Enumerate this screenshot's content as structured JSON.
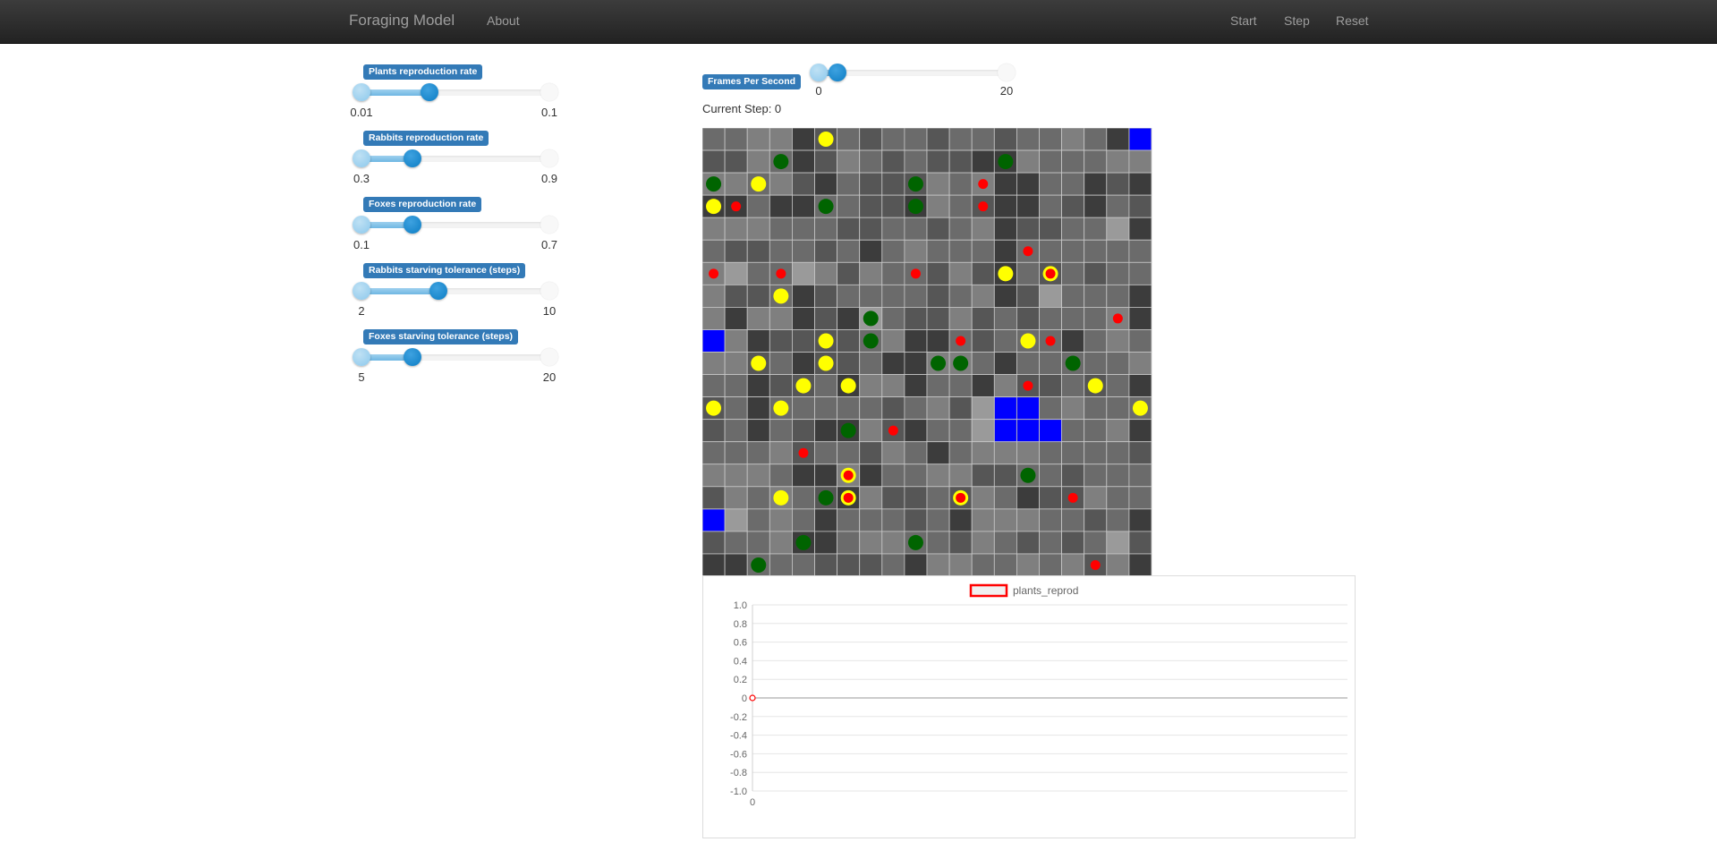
{
  "nav": {
    "brand": "Foraging Model",
    "about": "About",
    "start": "Start",
    "step": "Step",
    "reset": "Reset"
  },
  "params": [
    {
      "label": "Plants reproduction rate",
      "min": "0.01",
      "max": "0.1",
      "value_fraction": 0.36
    },
    {
      "label": "Rabbits reproduction rate",
      "min": "0.3",
      "max": "0.9",
      "value_fraction": 0.27
    },
    {
      "label": "Foxes reproduction rate",
      "min": "0.1",
      "max": "0.7",
      "value_fraction": 0.27
    },
    {
      "label": "Rabbits starving tolerance (steps)",
      "min": "2",
      "max": "10",
      "value_fraction": 0.41
    },
    {
      "label": "Foxes starving tolerance (steps)",
      "min": "5",
      "max": "20",
      "value_fraction": 0.27
    }
  ],
  "fps": {
    "label": "Frames Per Second",
    "min": "0",
    "max": "20",
    "value": 2
  },
  "status": {
    "current_step": "Current Step: 0"
  },
  "colors": {
    "plant": "#006400",
    "rabbit": "#ffff00",
    "fox": "#ff0000",
    "water": "#0000ff",
    "accent": "#337ab7"
  },
  "grid": {
    "width": 20,
    "height": 20,
    "shade_rows": [
      "22330121221221223204",
      "11320132121100322233",
      "33231021113230022010",
      "00200221103210021021",
      "33322211221230112240",
      "21122120232220222222",
      "34224313221310212122",
      "31120122221230142220",
      "30330104211312122230",
      "43011112300212220232",
      "33120112003320222223",
      "22011203302203112120",
      "12022222123144123222",
      "12021003102244322230",
      "22231221320233322221",
      "33320030223311221222",
      "13232103112132011322",
      "44232022212033322120",
      "12230023322132121241",
      "00222111203322323130"
    ],
    "shade_palette": [
      "#3c3c3c",
      "#565656",
      "#6b6b6b",
      "#7f7f7f",
      "#9a9a9a"
    ],
    "water": [
      [
        19,
        0
      ],
      [
        0,
        9
      ],
      [
        13,
        12
      ],
      [
        14,
        12
      ],
      [
        13,
        13
      ],
      [
        14,
        13
      ],
      [
        15,
        13
      ],
      [
        0,
        17
      ]
    ],
    "plants": [
      [
        3,
        1
      ],
      [
        13,
        1
      ],
      [
        0,
        2
      ],
      [
        9,
        2
      ],
      [
        5,
        3
      ],
      [
        9,
        3
      ],
      [
        7,
        8
      ],
      [
        7,
        9
      ],
      [
        10,
        10
      ],
      [
        11,
        10
      ],
      [
        16,
        10
      ],
      [
        6,
        13
      ],
      [
        14,
        15
      ],
      [
        5,
        16
      ],
      [
        4,
        18
      ],
      [
        9,
        18
      ],
      [
        2,
        19
      ]
    ],
    "rabbits": [
      [
        5,
        0
      ],
      [
        2,
        2
      ],
      [
        0,
        3
      ],
      [
        13,
        6
      ],
      [
        3,
        7
      ],
      [
        5,
        9
      ],
      [
        14,
        9
      ],
      [
        2,
        10
      ],
      [
        5,
        10
      ],
      [
        4,
        11
      ],
      [
        6,
        11
      ],
      [
        17,
        11
      ],
      [
        0,
        12
      ],
      [
        3,
        12
      ],
      [
        19,
        12
      ],
      [
        3,
        16
      ]
    ],
    "foxes": [
      [
        12,
        2
      ],
      [
        1,
        3
      ],
      [
        12,
        3
      ],
      [
        14,
        5
      ],
      [
        0,
        6
      ],
      [
        3,
        6
      ],
      [
        9,
        6
      ],
      [
        18,
        8
      ],
      [
        11,
        9
      ],
      [
        15,
        9
      ],
      [
        14,
        11
      ],
      [
        8,
        13
      ],
      [
        4,
        14
      ],
      [
        16,
        16
      ],
      [
        17,
        19
      ]
    ],
    "rabbit_fox": [
      [
        15,
        6
      ],
      [
        6,
        15
      ],
      [
        6,
        16
      ],
      [
        11,
        16
      ]
    ]
  },
  "chart_data": {
    "type": "line",
    "series": [
      {
        "name": "plants_reprod",
        "x": [
          0
        ],
        "values": [
          0
        ]
      }
    ],
    "x_ticks": [
      "0"
    ],
    "y_ticks": [
      "1.0",
      "0.8",
      "0.6",
      "0.4",
      "0.2",
      "0",
      "-0.2",
      "-0.4",
      "-0.6",
      "-0.8",
      "-1.0"
    ],
    "ylim": [
      -1.0,
      1.0
    ],
    "grid": true,
    "legend_position": "top",
    "series_color": "#ff0000"
  }
}
